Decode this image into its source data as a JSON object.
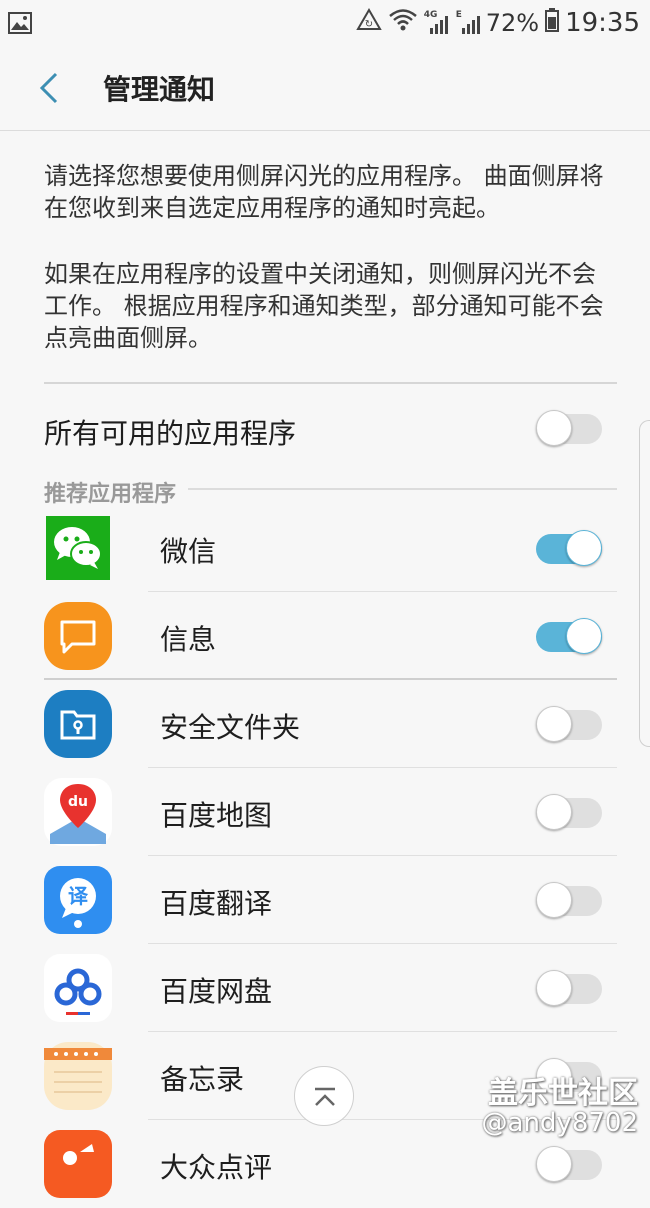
{
  "status_bar": {
    "network_label": "4G",
    "network_label2": "E",
    "battery": "72%",
    "time": "19:35"
  },
  "header": {
    "back_icon": "chevron-left-icon",
    "title": "管理通知"
  },
  "description": {
    "paragraph1": "请选择您想要使用侧屏闪光的应用程序。 曲面侧屏将在您收到来自选定应用程序的通知时亮起。",
    "paragraph2": "如果在应用程序的设置中关闭通知，则侧屏闪光不会工作。 根据应用程序和通知类型，部分通知可能不会点亮曲面侧屏。"
  },
  "all_apps": {
    "label": "所有可用的应用程序",
    "enabled": false
  },
  "section": {
    "label": "推荐应用程序"
  },
  "apps": [
    {
      "label": "微信",
      "icon": "wechat-icon",
      "enabled": true
    },
    {
      "label": "信息",
      "icon": "messages-icon",
      "enabled": true
    },
    {
      "label": "安全文件夹",
      "icon": "secure-folder-icon",
      "enabled": false
    },
    {
      "label": "百度地图",
      "icon": "baidu-map-icon",
      "enabled": false
    },
    {
      "label": "百度翻译",
      "icon": "baidu-translate-icon",
      "enabled": false
    },
    {
      "label": "百度网盘",
      "icon": "baidu-netdisk-icon",
      "enabled": false
    },
    {
      "label": "备忘录",
      "icon": "memo-icon",
      "enabled": false
    },
    {
      "label": "大众点评",
      "icon": "dianping-icon",
      "enabled": false
    }
  ],
  "watermark": {
    "line1": "盖乐世社区",
    "line2": "@andy8702"
  },
  "colors": {
    "toggle_on": "#5ab4d8",
    "accent": "#3d8fb3"
  }
}
